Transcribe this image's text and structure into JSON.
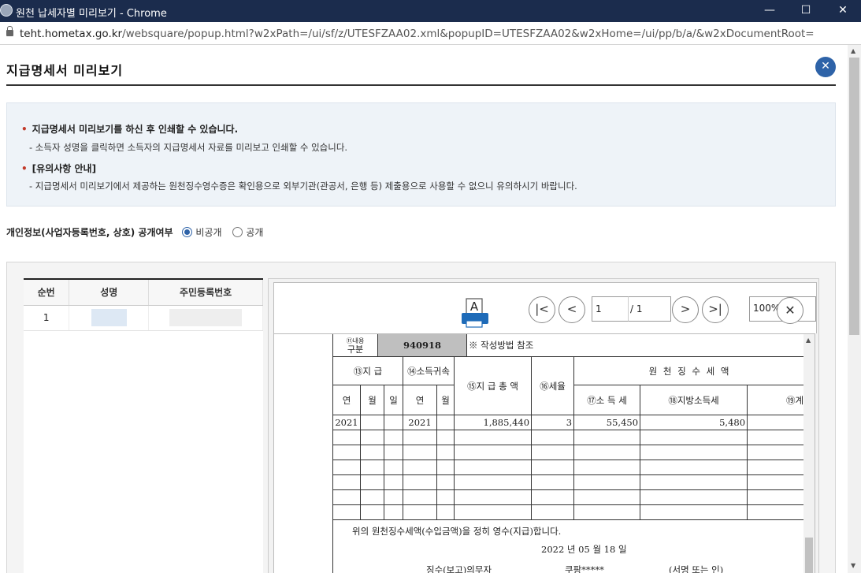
{
  "window": {
    "title": "원천 납세자별 미리보기 - Chrome",
    "minimize": "—",
    "maximize": "☐",
    "close": "✕"
  },
  "address": {
    "host": "teht.hometax.go.kr",
    "path": "/websquare/popup.html?w2xPath=/ui/sf/z/UTESFZAA02.xml&popupID=UTESFZAA02&w2xHome=/ui/pp/b/a/&w2xDocumentRoot="
  },
  "page": {
    "title": "지급명세서 미리보기",
    "close_label": "✕"
  },
  "notice": {
    "heading1": "지급명세서 미리보기를 하신 후 인쇄할 수 있습니다.",
    "desc1": "- 소득자 성명을 클릭하면 소득자의 지급명세서 자료를 미리보고 인쇄할 수 있습니다.",
    "heading2": "[유의사항 안내]",
    "desc2": "- 지급명세서 미리보기에서 제공하는 원천징수영수증은 확인용으로 외부기관(관공서, 은행 등) 제출용으로 사용할 수 없으니 유의하시기 바랍니다."
  },
  "privacy": {
    "label": "개인정보(사업자등록번호, 상호) 공개여부",
    "options": [
      "비공개",
      "공개"
    ],
    "selected": "비공개"
  },
  "taxpayer_table": {
    "headers": [
      "순번",
      "성명",
      "주민등록번호"
    ],
    "rows": [
      {
        "no": "1"
      }
    ]
  },
  "viewer": {
    "print_glyph": "A",
    "first": "|<",
    "prev": "<",
    "page_current": "1",
    "page_total": "/ 1",
    "next": ">",
    "last": ">|",
    "zoom": "100%",
    "zoom_close": "✕"
  },
  "document": {
    "top_cell_label": "구분",
    "top_cell_num": "⑪내용",
    "top_code": "940918",
    "top_note": "※ 작성방법 참조",
    "h_pay": "⑬지  급",
    "h_attr": "⑭소득귀속",
    "h_total": "⑮지 급 총 액",
    "h_rate": "⑯세율",
    "h_withholding": "원 천 징 수 세 액",
    "h_year": "연",
    "h_month": "월",
    "h_day": "일",
    "h_income_tax": "⑰소 득 세",
    "h_local_tax": "⑱지방소득세",
    "h_sum": "⑲계",
    "row": {
      "pay_year": "2021",
      "attr_year": "2021",
      "total": "1,885,440",
      "rate": "3",
      "income_tax": "55,450",
      "local_tax": "5,480"
    },
    "receipt_text": "위의 원천징수세액(수입금액)을 정히 영수(지급)합니다.",
    "date_text": "2022 년 05 월 18 일",
    "sign_left": "징수(보고)의무자",
    "sign_mid": "쿠팡*****",
    "sign_right": "(서명 또는 인)"
  }
}
